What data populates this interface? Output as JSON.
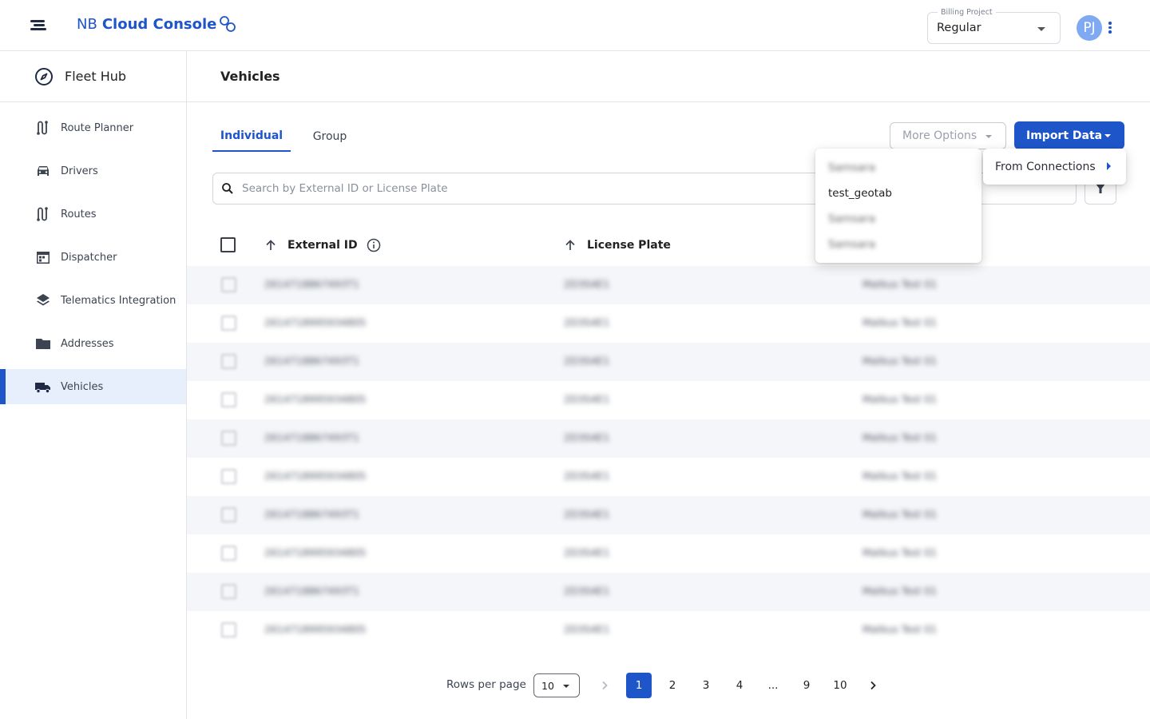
{
  "app": {
    "brand_prefix": "NB",
    "brand_name": "Cloud Console"
  },
  "header": {
    "billing_label": "Billing Project",
    "billing_value": "Regular",
    "avatar_initials": "PJ"
  },
  "sidebar": {
    "hub_title": "Fleet Hub",
    "items": [
      {
        "label": "Route Planner",
        "icon": "route-icon"
      },
      {
        "label": "Drivers",
        "icon": "car-icon"
      },
      {
        "label": "Routes",
        "icon": "route-icon"
      },
      {
        "label": "Dispatcher",
        "icon": "calendar-icon"
      },
      {
        "label": "Telematics Integration",
        "icon": "layers-icon"
      },
      {
        "label": "Addresses",
        "icon": "folder-icon"
      },
      {
        "label": "Vehicles",
        "icon": "truck-icon",
        "active": true
      }
    ]
  },
  "page": {
    "title": "Vehicles"
  },
  "tabs": [
    {
      "label": "Individual",
      "active": true
    },
    {
      "label": "Group",
      "active": false
    }
  ],
  "toolbar": {
    "more_options_label": "More Options",
    "import_data_label": "Import Data"
  },
  "search": {
    "placeholder": "Search by External ID or License Plate"
  },
  "table": {
    "headers": {
      "external_id": "External ID",
      "license_plate": "License Plate"
    },
    "rows": [
      {
        "external_id": "2614718867493T1",
        "license_plate": "2D3S4E1",
        "connection": "Matkus Test 01"
      },
      {
        "external_id": "2614718995934805",
        "license_plate": "2D3S4E1",
        "connection": "Matkus Test 01"
      },
      {
        "external_id": "2614718867493T1",
        "license_plate": "2D3S4E1",
        "connection": "Matkus Test 01"
      },
      {
        "external_id": "2614718995934805",
        "license_plate": "2D3S4E1",
        "connection": "Matkus Test 01"
      },
      {
        "external_id": "2614718867493T1",
        "license_plate": "2D3S4E1",
        "connection": "Matkus Test 01"
      },
      {
        "external_id": "2614718995934805",
        "license_plate": "2D3S4E1",
        "connection": "Matkus Test 01"
      },
      {
        "external_id": "2614718867493T1",
        "license_plate": "2D3S4E1",
        "connection": "Matkus Test 01"
      },
      {
        "external_id": "2614718995934805",
        "license_plate": "2D3S4E1",
        "connection": "Matkus Test 01"
      },
      {
        "external_id": "2614718867493T1",
        "license_plate": "2D3S4E1",
        "connection": "Matkus Test 01"
      },
      {
        "external_id": "2614718995934805",
        "license_plate": "2D3S4E1",
        "connection": "Matkus Test 01"
      }
    ]
  },
  "pagination": {
    "rows_per_page_label": "Rows per page",
    "rows_per_page_value": "10",
    "pages": [
      "1",
      "2",
      "3",
      "4",
      "...",
      "9",
      "10"
    ],
    "current_page": "1"
  },
  "import_menu": {
    "item_label": "From Connections"
  },
  "connections_menu": {
    "items": [
      {
        "label": "Samsara",
        "blurred": true
      },
      {
        "label": "test_geotab",
        "blurred": false
      },
      {
        "label": "Samsara",
        "blurred": true
      },
      {
        "label": "Samsara",
        "blurred": true
      }
    ]
  },
  "colors": {
    "accent": "#1e55c9",
    "active_nav_bg": "#e7eefc",
    "row_stripe": "#f5f6f9",
    "avatar_bg": "#7faaf1"
  }
}
